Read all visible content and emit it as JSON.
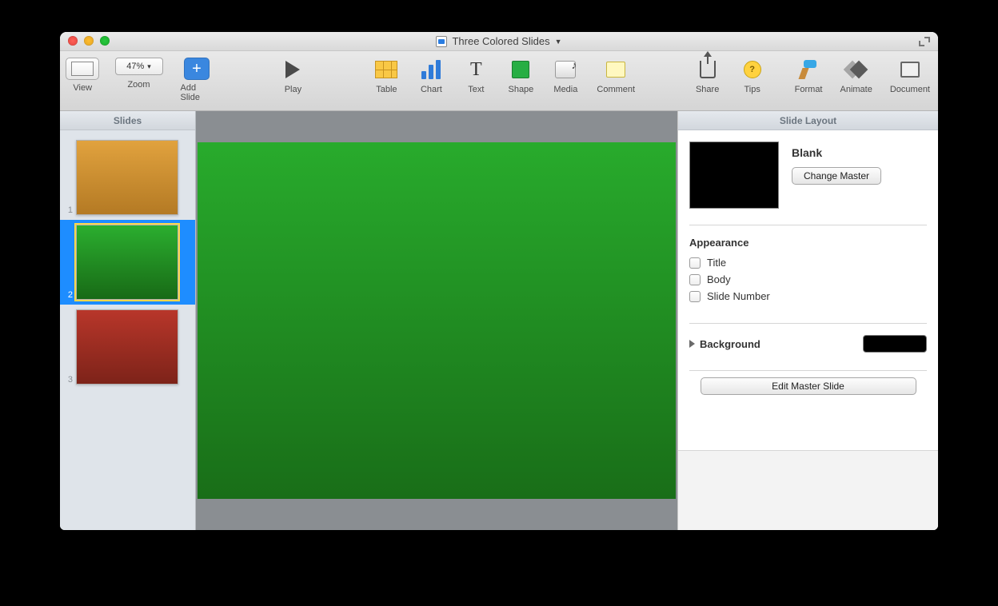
{
  "window": {
    "title": "Three Colored Slides"
  },
  "toolbar": {
    "view": "View",
    "zoom_label": "Zoom",
    "zoom_value": "47%",
    "add_slide": "Add Slide",
    "play": "Play",
    "table": "Table",
    "chart": "Chart",
    "text": "Text",
    "shape": "Shape",
    "media": "Media",
    "comment": "Comment",
    "share": "Share",
    "tips": "Tips",
    "format": "Format",
    "animate": "Animate",
    "document": "Document"
  },
  "sidebar": {
    "header": "Slides",
    "slides": [
      {
        "num": "1",
        "color": "orange"
      },
      {
        "num": "2",
        "color": "green"
      },
      {
        "num": "3",
        "color": "red"
      }
    ],
    "selected_index": 1
  },
  "inspector": {
    "header": "Slide Layout",
    "master_name": "Blank",
    "change_master": "Change Master",
    "appearance_label": "Appearance",
    "checks": {
      "title": "Title",
      "body": "Body",
      "slide_number": "Slide Number"
    },
    "background_label": "Background",
    "background_color": "#000000",
    "edit_master": "Edit Master Slide"
  }
}
